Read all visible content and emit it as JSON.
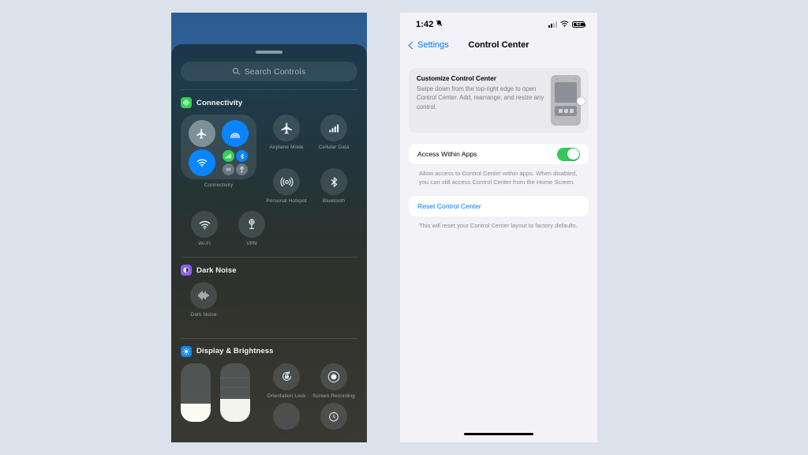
{
  "background_color": "#dbe2ec",
  "control_center_phone": {
    "search": {
      "placeholder": "Search Controls",
      "icon": "search-icon"
    },
    "groups": [
      {
        "name": "Connectivity",
        "icon": "connectivity-badge-icon",
        "icon_color": "#30d158",
        "module": {
          "label": "Connectivity",
          "cells": [
            {
              "name": "Airplane Mode",
              "icon": "airplane-icon",
              "state": "off",
              "color": "#bec8d0"
            },
            {
              "name": "AirDrop",
              "icon": "airdrop-icon",
              "state": "on",
              "color": "#0a84ff"
            },
            {
              "name": "Wi-Fi",
              "icon": "wifi-icon",
              "state": "on",
              "color": "#0a84ff"
            },
            {
              "name": "Cellular Data",
              "icon": "cellular-bars-icon",
              "state": "on",
              "color": "#30d158"
            },
            {
              "name": "Bluetooth",
              "icon": "bluetooth-icon",
              "state": "on",
              "color": "#0a84ff"
            },
            {
              "name": "Personal Hotspot",
              "icon": "hotspot-icon",
              "state": "off",
              "color": "#96a3ac"
            },
            {
              "name": "VPN",
              "icon": "vpn-icon",
              "state": "off",
              "color": "#96a3ac"
            }
          ]
        },
        "tiles_row1": [
          {
            "label": "Airplane Mode",
            "icon": "airplane-icon"
          },
          {
            "label": "Cellular Data",
            "icon": "cellular-bars-icon"
          }
        ],
        "tiles_row2": [
          {
            "label": "Personal Hotspot",
            "icon": "hotspot-icon"
          },
          {
            "label": "Bluetooth",
            "icon": "bluetooth-icon"
          }
        ],
        "tiles_row3": [
          {
            "label": "Wi-Fi",
            "icon": "wifi-icon"
          },
          {
            "label": "VPN",
            "icon": "vpn-icon"
          }
        ]
      },
      {
        "name": "Dark Noise",
        "icon": "dark-noise-badge-icon",
        "icon_color": "#8b5cf6",
        "tiles": [
          {
            "label": "Dark Noise",
            "icon": "waveform-icon"
          }
        ]
      },
      {
        "name": "Display & Brightness",
        "icon": "brightness-badge-icon",
        "icon_color": "#0a84ff",
        "sliders": [
          {
            "name": "Brightness",
            "value": 30
          },
          {
            "name": "Volume",
            "value": 38
          }
        ],
        "tiles": [
          {
            "label": "Orientation Lock",
            "icon": "rotation-lock-icon"
          },
          {
            "label": "Screen Recording",
            "icon": "screen-record-icon"
          }
        ]
      }
    ]
  },
  "settings_phone": {
    "status_bar": {
      "time": "1:42",
      "silent_icon": "bell-slash-icon",
      "cellular_icon": "cellular-bars-icon",
      "wifi_icon": "wifi-icon",
      "battery_icon": "battery-icon",
      "battery_percent": "63"
    },
    "nav": {
      "back_label": "Settings",
      "back_icon": "chevron-left-icon",
      "title": "Control Center"
    },
    "customize_card": {
      "title": "Customize Control Center",
      "description": "Swipe down from the top-right edge to open Control Center. Add, rearrange, and resize any control.",
      "illustration": "phone-control-center-illustration"
    },
    "access_section": {
      "row_label": "Access Within Apps",
      "toggle_state": "on",
      "toggle_color": "#34c759",
      "footnote": "Allow access to Control Center within apps. When disabled, you can still access Control Center from the Home Screen."
    },
    "reset_section": {
      "row_label": "Reset Control Center",
      "link_color": "#007aff",
      "footnote": "This will reset your Control Center layout to factory defaults."
    },
    "home_indicator": "home-indicator"
  }
}
